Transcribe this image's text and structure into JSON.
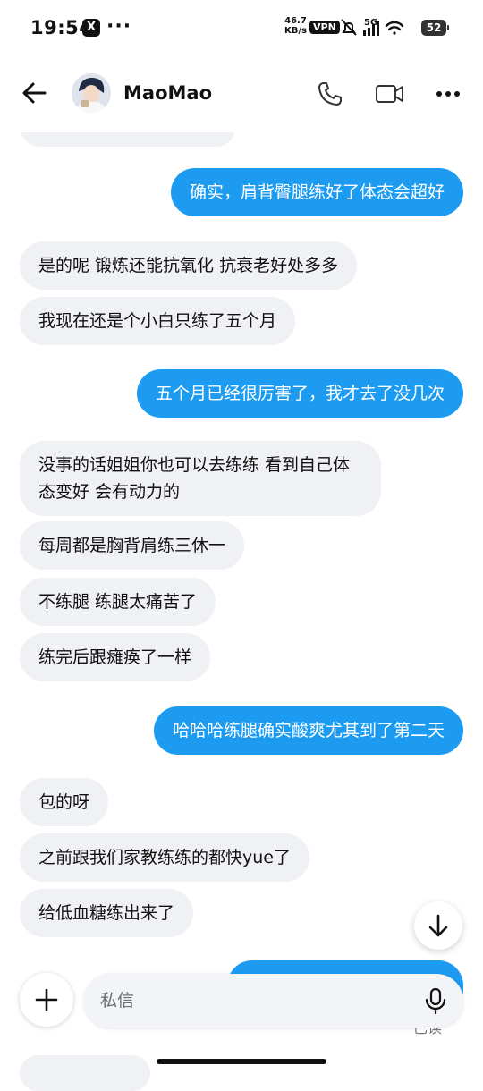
{
  "status_bar": {
    "time": "19:54",
    "x_badge": "X",
    "more_dots": "···",
    "net_speed_value": "46.7",
    "net_speed_unit": "KB/s",
    "vpn": "VPN",
    "network": "5G",
    "battery": "52"
  },
  "header": {
    "contact_name": "MaoMao"
  },
  "messages": [
    {
      "side": "received",
      "text": "是的呢 锻炼还能抗氧化 抗衰老好处多多"
    },
    {
      "side": "received",
      "text": "我现在还是个小白只练了五个月"
    },
    {
      "side": "sent",
      "text": "五个月已经很厉害了，我才去了没几次"
    },
    {
      "side": "received",
      "text": "没事的话姐姐你也可以去练练 看到自己体态变好 会有动力的"
    },
    {
      "side": "received",
      "text": "每周都是胸背肩练三休一"
    },
    {
      "side": "received",
      "text": "不练腿 练腿太痛苦了"
    },
    {
      "side": "received",
      "text": "练完后跟瘫痪了一样"
    },
    {
      "side": "sent",
      "text": "哈哈哈练腿确实酸爽尤其到了第二天"
    },
    {
      "side": "received",
      "text": "包的呀"
    },
    {
      "side": "received",
      "text": "之前跟我们家教练练的都快yue了"
    },
    {
      "side": "received",
      "text": "给低血糖练出来了"
    }
  ],
  "top_sent_message": "确实，肩背臀腿练好了体态会超好",
  "composer": {
    "placeholder": "私信"
  },
  "read_receipt": "已读",
  "colors": {
    "sent_bubble": "#1d9bf0",
    "received_bubble": "#f0f1f4"
  }
}
